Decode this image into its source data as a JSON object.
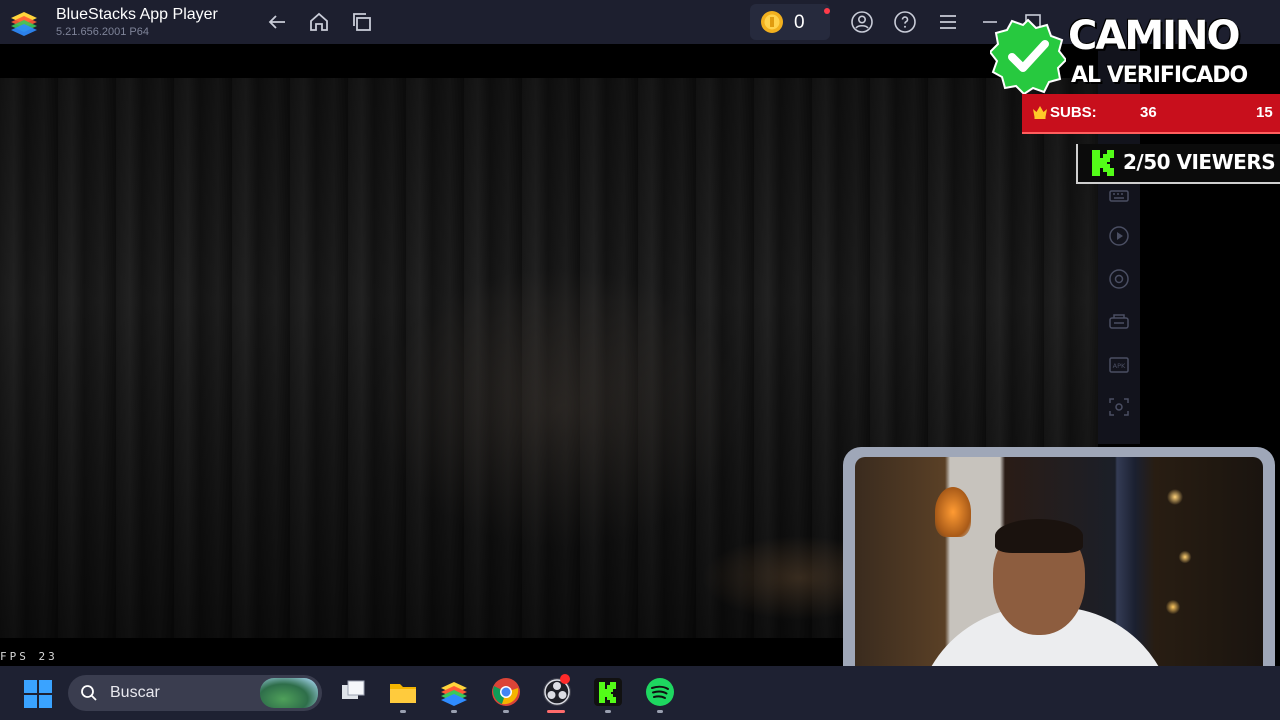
{
  "titlebar": {
    "app_name": "BlueStacks App Player",
    "version": "5.21.656.2001 P64",
    "coins": "0",
    "icons": [
      "bluestacks-logo",
      "back-icon",
      "home-icon",
      "multi-instance-icon",
      "coin-icon",
      "account-icon",
      "help-icon",
      "menu-icon",
      "minimize-icon",
      "maximize-icon"
    ]
  },
  "game": {
    "fps_label": "FPS",
    "fps_value": "23"
  },
  "sidebar": {
    "icons": [
      "keyboard-icon",
      "play-macro-icon",
      "record-icon",
      "gamepad-icon",
      "apk-icon",
      "screenshot-icon"
    ]
  },
  "overlay": {
    "headline": "CAMINO",
    "subheadline": "AL VERIFICADO",
    "subs_label": "SUBS:",
    "subs_count": "36",
    "subs_goal": "15",
    "viewers": "2/50 VIEWERS"
  },
  "taskbar": {
    "search_placeholder": "Buscar",
    "apps": [
      "task-view",
      "file-explorer",
      "bluestacks",
      "chrome",
      "obs-studio",
      "kick",
      "spotify"
    ]
  },
  "colors": {
    "titlebar_bg": "#1d1f2f",
    "taskbar_bg": "#1e2132",
    "subs_red": "#c80f1c",
    "kick_green": "#53fc18",
    "verify_green": "#27c93f"
  }
}
